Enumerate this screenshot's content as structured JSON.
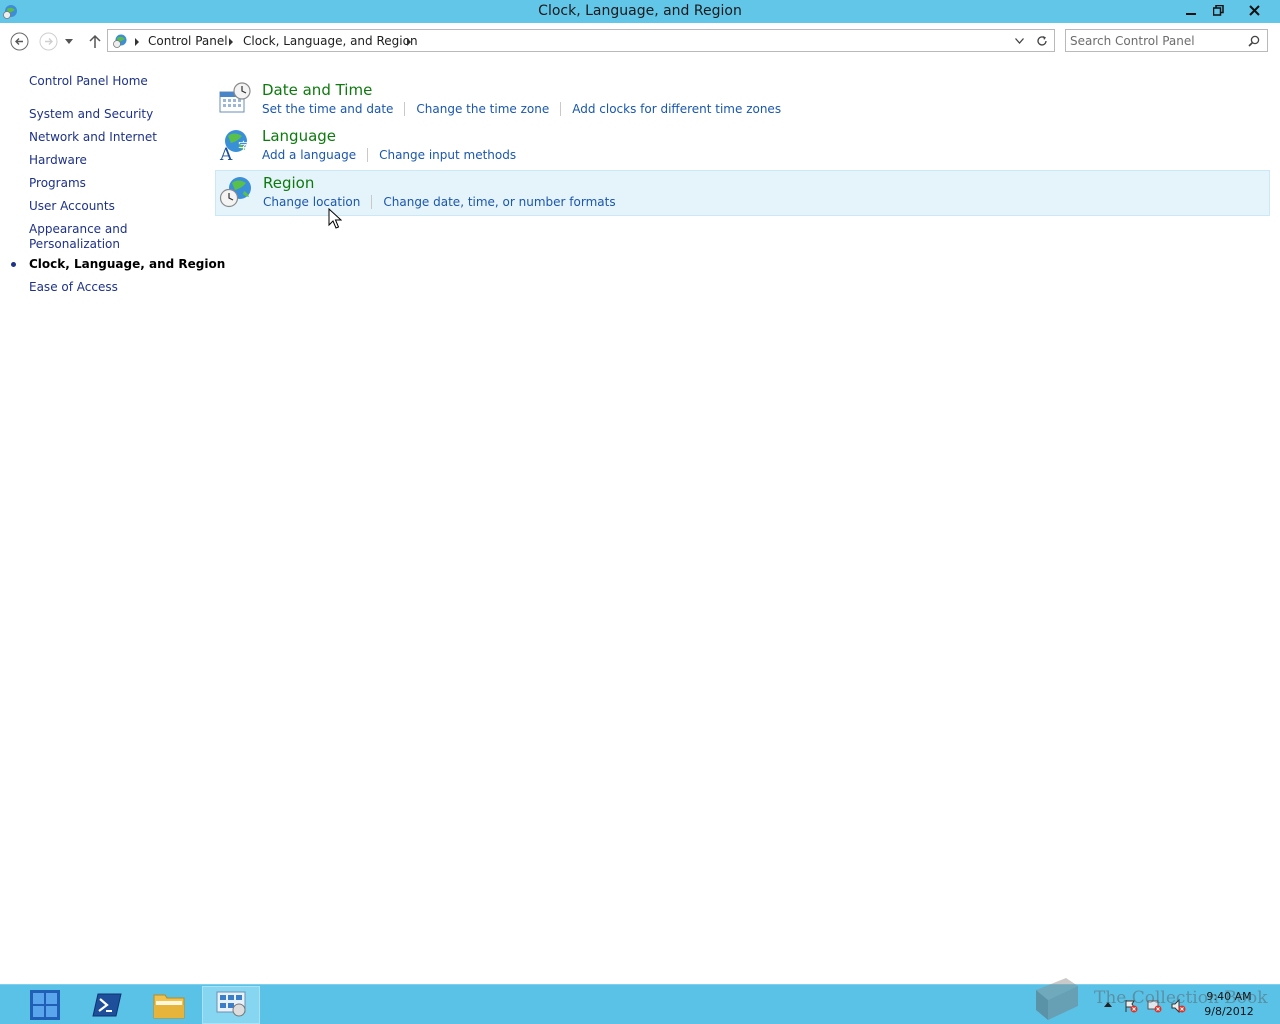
{
  "window": {
    "title": "Clock, Language, and Region"
  },
  "addressbar": {
    "crumbs": [
      "Control Panel",
      "Clock, Language, and Region"
    ]
  },
  "search": {
    "placeholder": "Search Control Panel"
  },
  "leftnav": {
    "home": "Control Panel Home",
    "items": [
      "System and Security",
      "Network and Internet",
      "Hardware",
      "Programs",
      "User Accounts",
      "Appearance and",
      "Personalization",
      "Clock, Language, and Region",
      "Ease of Access"
    ]
  },
  "categories": [
    {
      "heading": "Date and Time",
      "icon": "calendar-clock-icon",
      "links": [
        "Set the time and date",
        "Change the time zone",
        "Add clocks for different time zones"
      ]
    },
    {
      "heading": "Language",
      "icon": "language-globe-icon",
      "links": [
        "Add a language",
        "Change input methods"
      ]
    },
    {
      "heading": "Region",
      "icon": "region-globe-clock-icon",
      "links": [
        "Change location",
        "Change date, time, or number formats"
      ]
    }
  ],
  "taskbar": {
    "time": "9:40 AM",
    "date": "9/8/2012",
    "watermark": "The Collection Book"
  },
  "colors": {
    "titlebar": "#62c6e9",
    "taskbar": "#5bc2e7",
    "heading_green": "#0d7a0d",
    "link_blue": "#1a57ad",
    "hover_bg": "#e5f3fb"
  }
}
